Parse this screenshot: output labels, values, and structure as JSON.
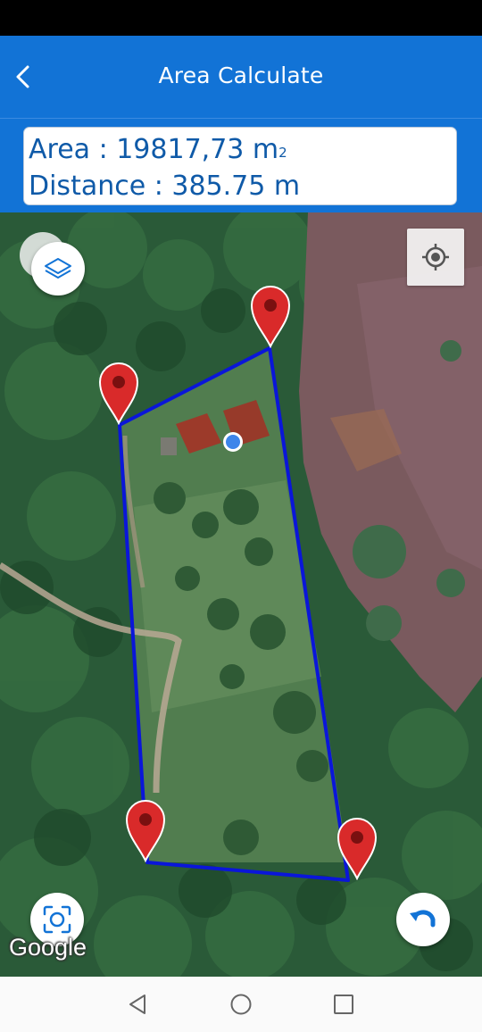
{
  "header": {
    "title": "Area Calculate",
    "back_icon": "chevron-left-icon"
  },
  "measurement": {
    "area_label": "Area : ",
    "area_value": "19817,73 m",
    "area_unit_sup": "2",
    "distance_label": "Distance : ",
    "distance_value": "385.75 m"
  },
  "map": {
    "attribution": "Google",
    "polygon_color": "#0a16d9",
    "marker_color": "#d92a2a",
    "controls": {
      "layers_icon": "layers-icon",
      "my_location_icon": "crosshair-icon",
      "screenshot_icon": "screenshot-frame-icon",
      "undo_icon": "undo-icon"
    }
  },
  "nav": {
    "back_icon": "triangle-back-icon",
    "home_icon": "circle-home-icon",
    "recents_icon": "square-recents-icon"
  },
  "colors": {
    "app_bar": "#1273d6",
    "info_text": "#0f5aa8"
  }
}
